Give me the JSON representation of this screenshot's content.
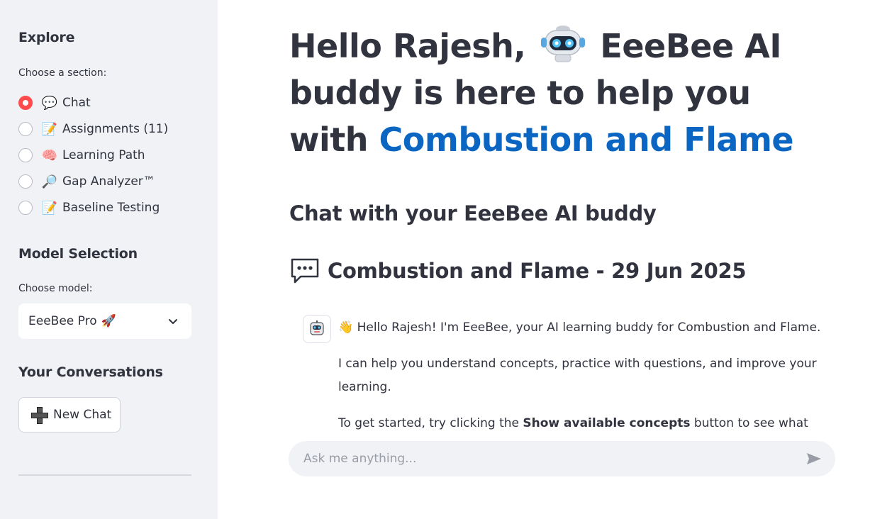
{
  "sidebar": {
    "explore_heading": "Explore",
    "section_label": "Choose a section:",
    "sections": [
      {
        "glyph": "💬",
        "label": "Chat",
        "selected": true
      },
      {
        "glyph": "📝",
        "label": "Assignments (11)",
        "selected": false
      },
      {
        "glyph": "🧠",
        "label": "Learning Path",
        "selected": false
      },
      {
        "glyph": "🔎",
        "label": "Gap Analyzer™",
        "selected": false
      },
      {
        "glyph": "📝",
        "label": "Baseline Testing",
        "selected": false
      }
    ],
    "model_heading": "Model Selection",
    "model_label": "Choose model:",
    "model_selected": "EeeBee Pro",
    "model_glyph": "🚀",
    "conversations_heading": "Your Conversations",
    "new_chat_label": "New Chat"
  },
  "main": {
    "hero_part1": "Hello Rajesh,",
    "hero_part2": "EeeBee AI buddy is here to help you with",
    "hero_subject": "Combustion and Flame",
    "sub_heading": "Chat with your EeeBee AI buddy",
    "chat_title": "Combustion and Flame - 29 Jun 2025",
    "message": {
      "wave_glyph": "👋",
      "line1": "Hello Rajesh! I'm EeeBee, your AI learning buddy for Combustion and Flame.",
      "line2": "I can help you understand concepts, practice with questions, and improve your learning.",
      "line3_prefix": "To get started, try clicking the ",
      "line3_bold": "Show available concepts",
      "line3_suffix": " button to see what we can"
    },
    "input_placeholder": "Ask me anything..."
  },
  "colors": {
    "accent_blue": "#0a66c2",
    "radio_selected": "#ff4b4b",
    "sidebar_bg": "#f0f2f6"
  },
  "icons": {
    "robot": "robot-icon",
    "chat_bubble": "chat-bubble-icon",
    "send": "send-icon",
    "plus": "plus-icon",
    "chevron": "chevron-down-icon"
  }
}
